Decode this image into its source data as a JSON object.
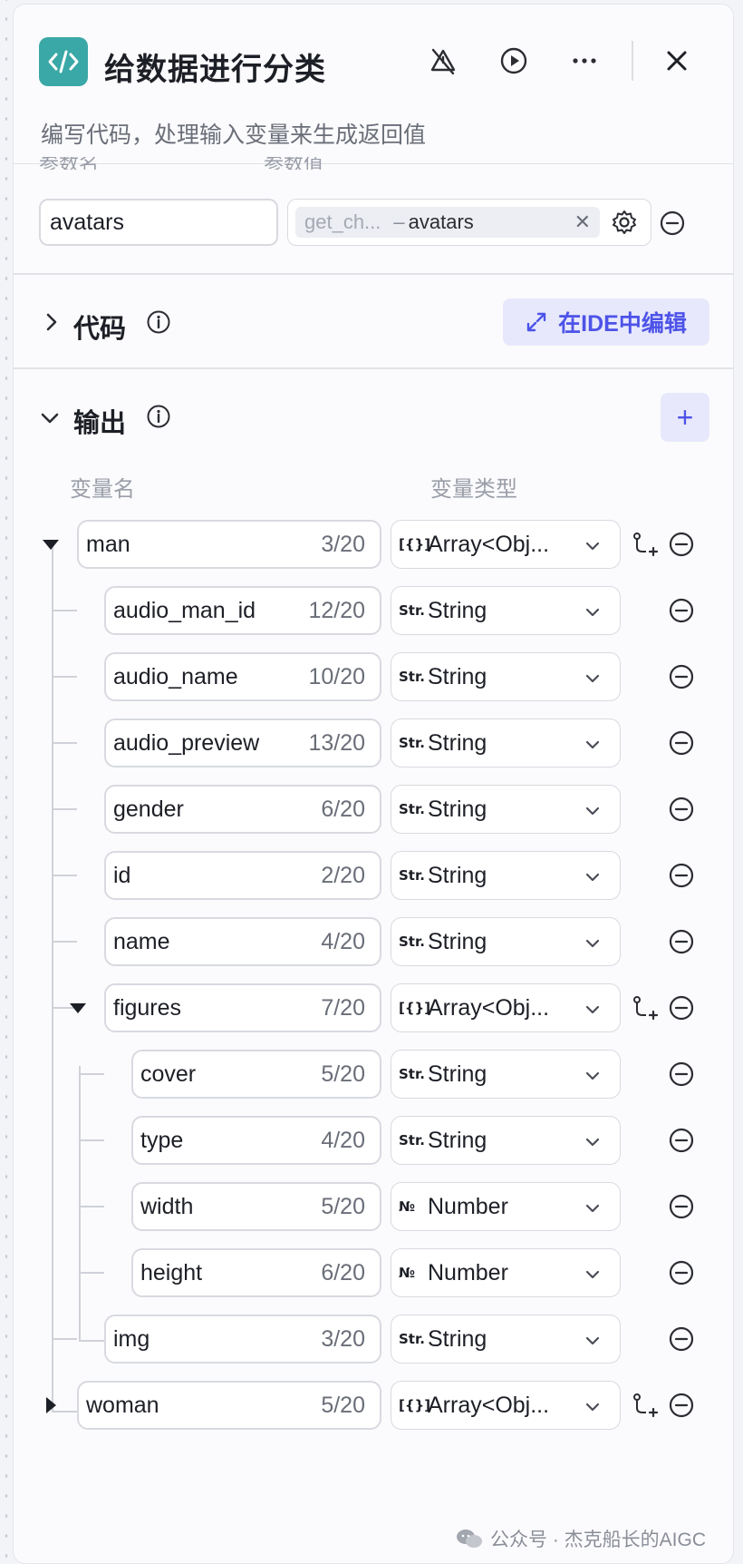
{
  "header": {
    "title": "给数据进行分类",
    "subtitle": "编写代码，处理输入变量来生成返回值"
  },
  "params": {
    "name_label": "参数名",
    "value_label": "参数值",
    "name_value": "avatars",
    "ref_node": "get_ch...",
    "ref_dash": "–",
    "ref_var": "avatars"
  },
  "code_section": {
    "title": "代码",
    "ide_button": "在IDE中编辑"
  },
  "output_section": {
    "title": "输出",
    "col_name": "变量名",
    "col_type": "变量类型",
    "rows": [
      {
        "name": "man",
        "count": "3/20",
        "type_icon": "[{}]",
        "type": "Array<Obj..."
      },
      {
        "name": "audio_man_id",
        "count": "12/20",
        "type_icon": "Str.",
        "type": "String"
      },
      {
        "name": "audio_name",
        "count": "10/20",
        "type_icon": "Str.",
        "type": "String"
      },
      {
        "name": "audio_preview",
        "count": "13/20",
        "type_icon": "Str.",
        "type": "String"
      },
      {
        "name": "gender",
        "count": "6/20",
        "type_icon": "Str.",
        "type": "String"
      },
      {
        "name": "id",
        "count": "2/20",
        "type_icon": "Str.",
        "type": "String"
      },
      {
        "name": "name",
        "count": "4/20",
        "type_icon": "Str.",
        "type": "String"
      },
      {
        "name": "figures",
        "count": "7/20",
        "type_icon": "[{}]",
        "type": "Array<Obj..."
      },
      {
        "name": "cover",
        "count": "5/20",
        "type_icon": "Str.",
        "type": "String"
      },
      {
        "name": "type",
        "count": "4/20",
        "type_icon": "Str.",
        "type": "String"
      },
      {
        "name": "width",
        "count": "5/20",
        "type_icon": "№",
        "type": "Number"
      },
      {
        "name": "height",
        "count": "6/20",
        "type_icon": "№",
        "type": "Number"
      },
      {
        "name": "img",
        "count": "3/20",
        "type_icon": "Str.",
        "type": "String"
      },
      {
        "name": "woman",
        "count": "5/20",
        "type_icon": "[{}]",
        "type": "Array<Obj..."
      }
    ]
  },
  "watermark": "公众号 · 杰克船长的AIGC",
  "colors": {
    "accent": "#4d53e8",
    "app_icon": "#3aa8a6"
  }
}
